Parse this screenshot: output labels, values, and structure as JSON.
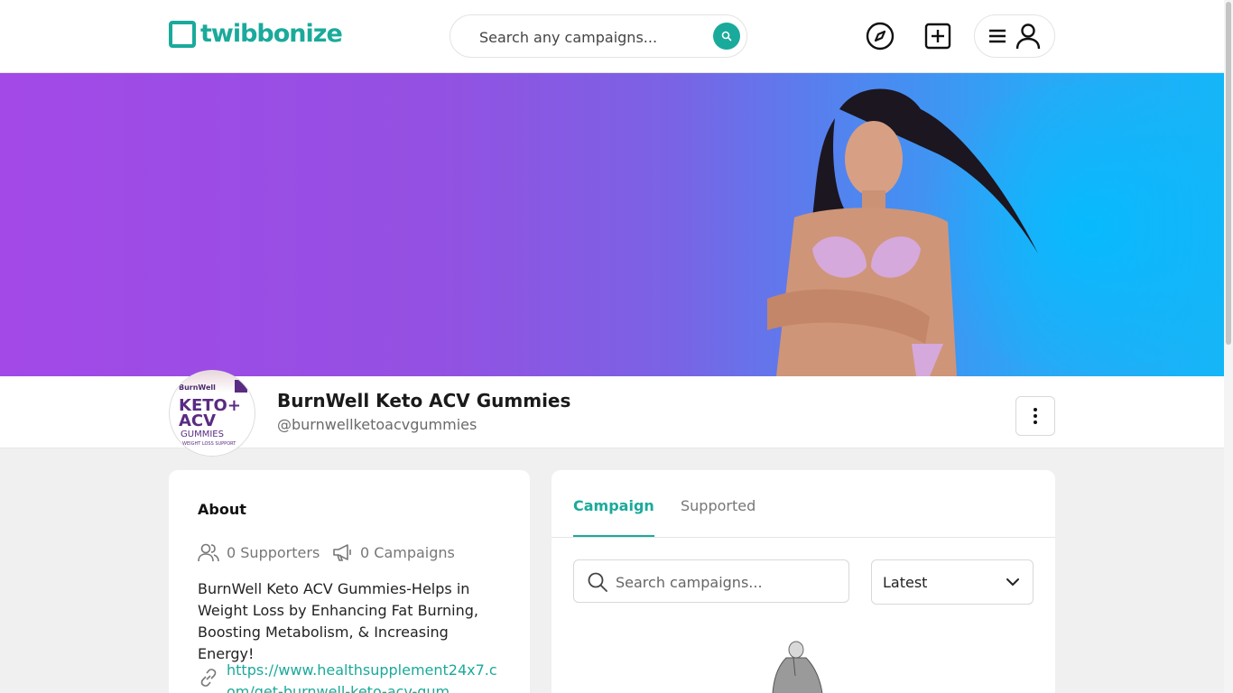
{
  "header": {
    "logo_text": "twibbonize",
    "search_placeholder": "Search any campaigns...",
    "icons": [
      "compass-icon",
      "plus-square-icon",
      "menu-icon",
      "user-icon"
    ]
  },
  "profile": {
    "name": "BurnWell Keto ACV Gummies",
    "handle": "@burnwellketoacvgummies",
    "avatar": {
      "brand": "BurnWell",
      "product": "KETO+ ACV",
      "sub": "GUMMIES",
      "tagline": "WEIGHT LOSS SUPPORT"
    }
  },
  "about": {
    "title": "About",
    "supporters": "0 Supporters",
    "campaigns": "0 Campaigns",
    "description": "BurnWell Keto ACV Gummies-Helps in Weight Loss by Enhancing Fat Burning, Boosting Metabolism, & Increasing Energy!",
    "link": "https://www.healthsupplement24x7.com/get-burnwell-keto-acv-gum"
  },
  "campaigns": {
    "tabs": [
      {
        "label": "Campaign",
        "active": true
      },
      {
        "label": "Supported",
        "active": false
      }
    ],
    "search_placeholder": "Search campaigns...",
    "sort_selected": "Latest"
  },
  "colors": {
    "accent": "#1aaa9b",
    "banner_start": "#a349e8",
    "banner_end": "#14b6f8"
  }
}
